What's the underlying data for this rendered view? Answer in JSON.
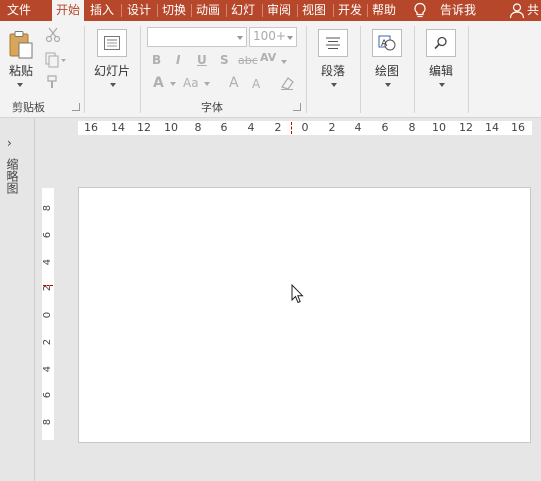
{
  "tabs": {
    "file": "文件",
    "home": "开始",
    "insert": "插入",
    "design": "设计",
    "transitions": "切换",
    "animations": "动画",
    "slideshow": "幻灯",
    "review": "审阅",
    "view": "视图",
    "developer": "开发",
    "help": "帮助",
    "tell_me": "告诉我",
    "share": "共"
  },
  "ribbon": {
    "clipboard": {
      "paste_label": "粘贴",
      "group_label": "剪贴板"
    },
    "slides": {
      "new_slide_label": "幻灯片"
    },
    "font": {
      "group_label": "字体",
      "font_name": "",
      "font_size": "100+",
      "bold": "B",
      "italic": "I",
      "underline": "U",
      "strike": "S",
      "abc": "abc",
      "av": "AV",
      "font_color": "A",
      "case": "Aa",
      "grow": "A",
      "shrink": "A"
    },
    "paragraph": {
      "label": "段落"
    },
    "drawing": {
      "label": "绘图"
    },
    "editing": {
      "label": "编辑"
    }
  },
  "left_pane": {
    "label": "缩略图",
    "chevron": "›"
  },
  "ruler": {
    "horizontal": [
      "16",
      "14",
      "12",
      "10",
      "8",
      "6",
      "4",
      "2",
      "0",
      "2",
      "4",
      "6",
      "8",
      "10",
      "12",
      "14",
      "16"
    ],
    "vertical": [
      "8",
      "6",
      "4",
      "2",
      "0",
      "2",
      "4",
      "6",
      "8"
    ]
  },
  "colors": {
    "accent": "#b7472a",
    "ribbon_bg": "#f3f3f3",
    "workspace_bg": "#e6e6e6"
  }
}
